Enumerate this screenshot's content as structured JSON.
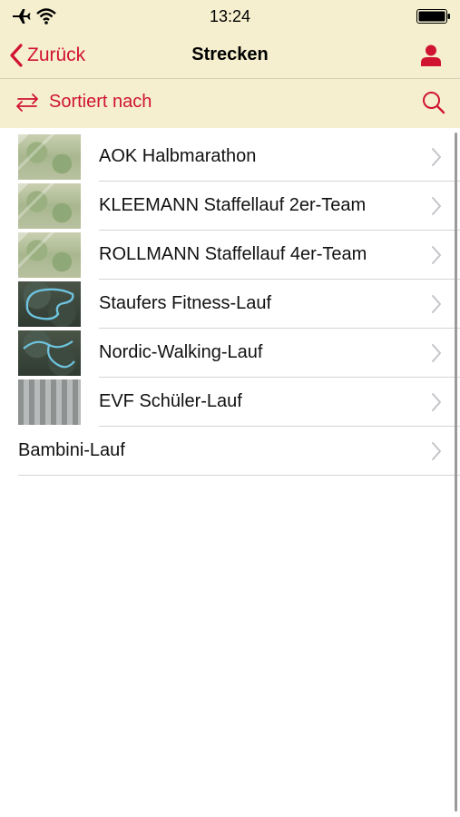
{
  "status_bar": {
    "time": "13:24",
    "icons": [
      "airplane-icon",
      "wifi-icon",
      "battery-icon"
    ]
  },
  "nav": {
    "back_label": "Zurück",
    "title": "Strecken",
    "user_icon": "user-icon"
  },
  "sort_bar": {
    "sort_label": "Sortiert nach",
    "sort_icon": "swap-arrows-icon",
    "search_icon": "search-icon"
  },
  "routes": [
    {
      "label": "AOK Halbmarathon",
      "thumbnail": "map-thumbnail"
    },
    {
      "label": "KLEEMANN Staffellauf 2er-Team",
      "thumbnail": "map-thumbnail"
    },
    {
      "label": "ROLLMANN Staffellauf 4er-Team",
      "thumbnail": "map-thumbnail"
    },
    {
      "label": "Staufers Fitness-Lauf",
      "thumbnail": "satellite-thumbnail"
    },
    {
      "label": "Nordic-Walking-Lauf",
      "thumbnail": "satellite-thumbnail"
    },
    {
      "label": "EVF Schüler-Lauf",
      "thumbnail": "satellite-thumbnail"
    },
    {
      "label": "Bambini-Lauf",
      "thumbnail": ""
    }
  ],
  "colors": {
    "accent": "#d0142f",
    "bar_background": "#f5efcf",
    "separator": "#d4d4d4"
  }
}
